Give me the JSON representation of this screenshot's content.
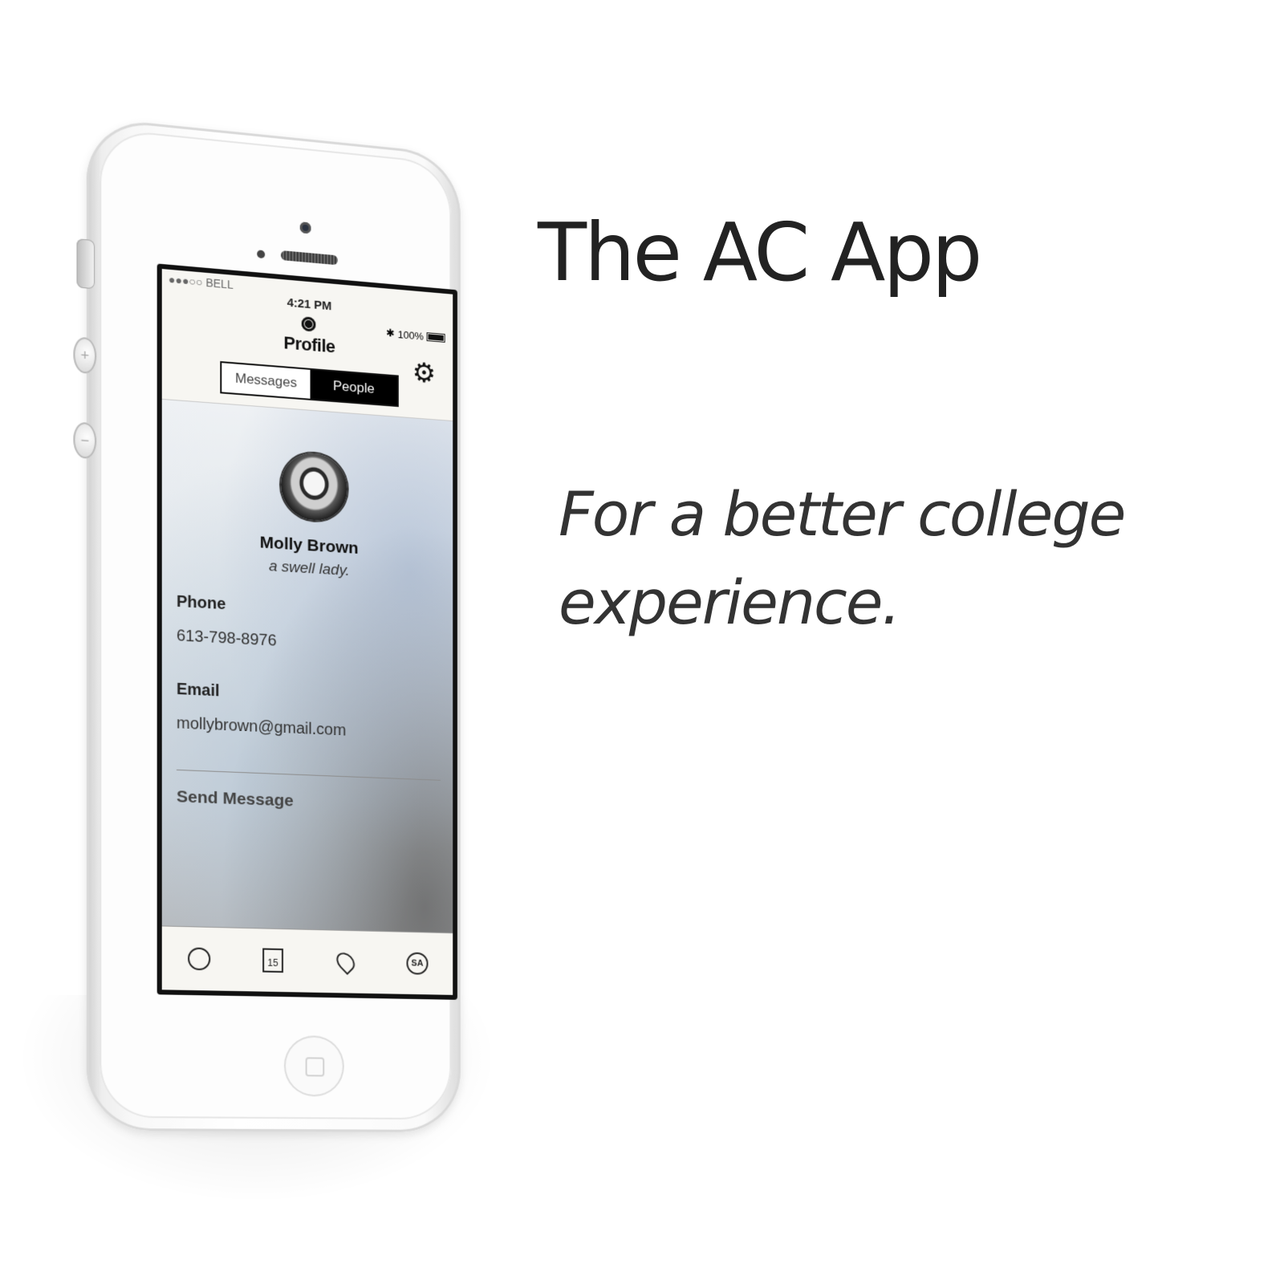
{
  "marketing": {
    "headline": "The AC App",
    "tagline": "For a better college experience."
  },
  "phone": {
    "status_bar": {
      "carrier": "●●●○○ BELL",
      "time": "4:21 PM",
      "battery": "100%"
    },
    "header": {
      "title": "Profile",
      "icon": "person-icon",
      "settings_icon": "gear-icon"
    },
    "segmented_control": {
      "options": [
        "Messages",
        "People"
      ],
      "selected": "People"
    },
    "profile": {
      "name": "Molly Brown",
      "tagline": "a swell lady.",
      "phone_label": "Phone",
      "phone_value": "613-798-8976",
      "email_label": "Email",
      "email_value": "mollybrown@gmail.com",
      "action": "Send Message"
    },
    "tab_bar": {
      "items": [
        {
          "icon": "profile-icon",
          "label": ""
        },
        {
          "icon": "calendar-icon",
          "label": "15"
        },
        {
          "icon": "location-pin-icon",
          "label": ""
        },
        {
          "icon": "sa-badge-icon",
          "label": "SA"
        }
      ]
    }
  },
  "colors": {
    "text_dark": "#222222",
    "segment_active": "#000000",
    "screen_bg": "#f7f6f2"
  }
}
